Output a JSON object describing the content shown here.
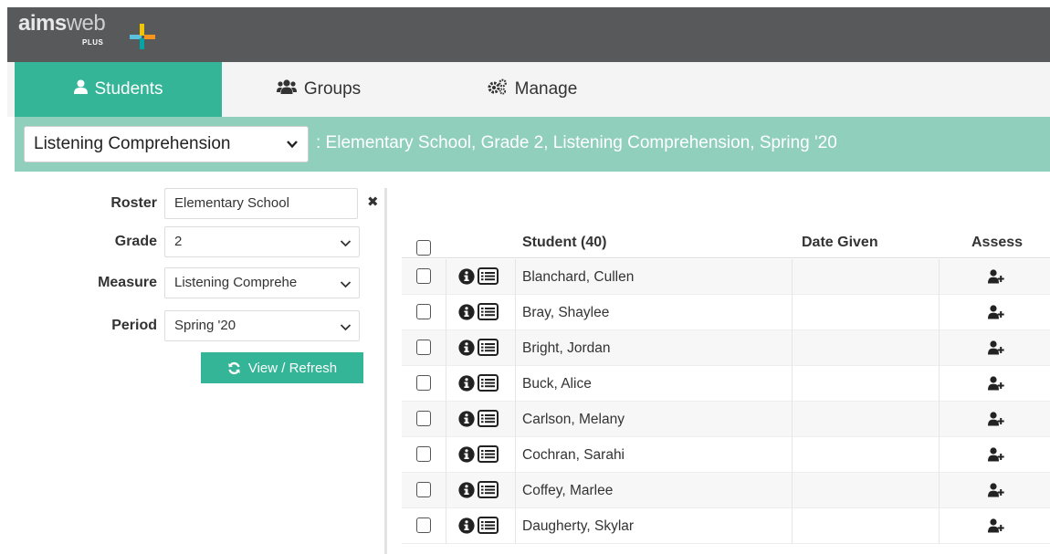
{
  "brand": {
    "logo_text_a": "aims",
    "logo_text_b": "web",
    "logo_plus": "PLUS"
  },
  "tabs": [
    {
      "label": "Students",
      "icon": "user-icon",
      "active": true
    },
    {
      "label": "Groups",
      "icon": "users-icon",
      "active": false
    },
    {
      "label": "Manage",
      "icon": "gears-icon",
      "active": false
    }
  ],
  "context": {
    "measure_selected": "Listening Comprehension",
    "title": ": Elementary School, Grade 2, Listening Comprehension, Spring '20"
  },
  "filters": {
    "roster_label": "Roster",
    "roster_value": "Elementary School",
    "grade_label": "Grade",
    "grade_value": "2",
    "measure_label": "Measure",
    "measure_value": "Listening Comprehe",
    "period_label": "Period",
    "period_value": "Spring '20",
    "refresh_label": "View / Refresh"
  },
  "table": {
    "col_student": "Student (40)",
    "col_date": "Date Given",
    "col_assess": "Assess",
    "rows": [
      {
        "name": "Blanchard, Cullen",
        "date": ""
      },
      {
        "name": "Bray, Shaylee",
        "date": ""
      },
      {
        "name": "Bright, Jordan",
        "date": ""
      },
      {
        "name": "Buck, Alice",
        "date": ""
      },
      {
        "name": "Carlson, Melany",
        "date": ""
      },
      {
        "name": "Cochran, Sarahi",
        "date": ""
      },
      {
        "name": "Coffey, Marlee",
        "date": ""
      },
      {
        "name": "Daugherty, Skylar",
        "date": ""
      }
    ]
  },
  "colors": {
    "accent": "#35b597",
    "context_bar": "#8fcfbc",
    "topbar": "#58595b"
  }
}
